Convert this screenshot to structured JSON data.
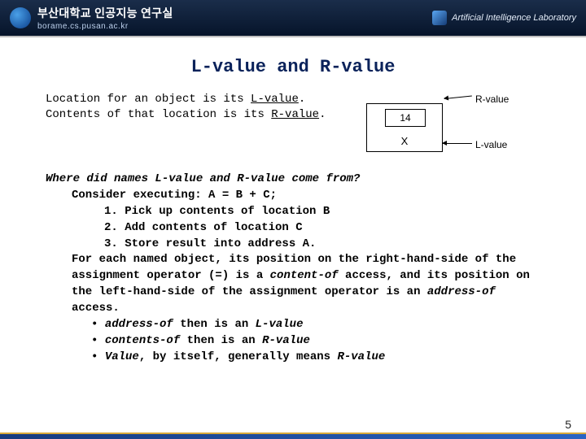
{
  "header": {
    "korean_title": "부산대학교 인공지능 연구실",
    "sub_url": "borame.cs.pusan.ac.kr",
    "lab_text": "Artificial Intelligence Laboratory"
  },
  "title": "L-value and R-value",
  "intro": {
    "part1": "Location for an object is its ",
    "lvalue": "L-value",
    "part2": ". Contents of that location is its ",
    "rvalue": "R-value",
    "part3": "."
  },
  "diagram": {
    "inner_text": "14",
    "x_label": "X",
    "r_label": "R-value",
    "l_label": "L-value"
  },
  "body": {
    "q_prefix": "Where did names L-value and R-value come from?",
    "consider": "Consider executing: A = B + C;",
    "step1": "1. Pick up contents of location B",
    "step2": "2. Add contents of location C",
    "step3": "3. Store result into address A.",
    "para_a": "For each named object, its position on the right-hand-side of the assignment operator (=) is a ",
    "content_of": "content-of",
    "para_b": " access, and its position on the left-hand-side of the assignment operator is an ",
    "address_of": "address-of",
    "para_c": " access.",
    "b1a": "• ",
    "b1b": "address-of",
    "b1c": " then is an ",
    "b1d": "L-value",
    "b2a": "• ",
    "b2b": "contents-of",
    "b2c": " then is an ",
    "b2d": "R-value",
    "b3a": "• ",
    "b3b": "Value",
    "b3c": ", by itself, generally means ",
    "b3d": "R-value"
  },
  "page_number": "5"
}
